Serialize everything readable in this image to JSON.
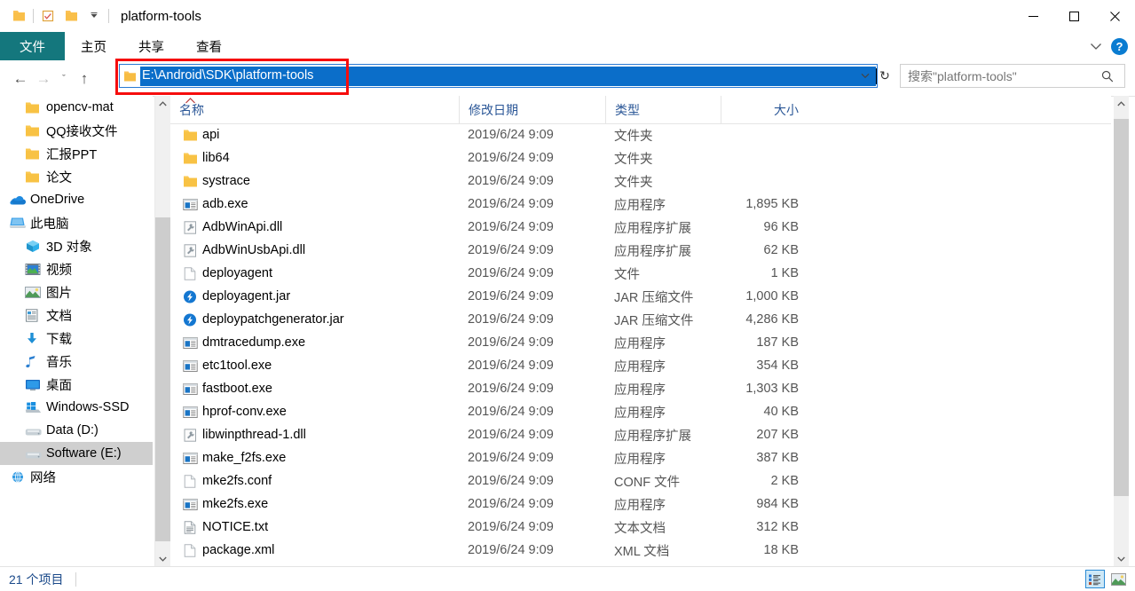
{
  "window": {
    "title": "platform-tools",
    "quick_access": [
      {
        "name": "folder-icon",
        "label": "folder"
      },
      {
        "name": "properties-icon",
        "label": "properties"
      },
      {
        "name": "new-folder-icon",
        "label": "new folder"
      },
      {
        "name": "chevron-down-icon",
        "label": "customize quick access toolbar"
      }
    ],
    "controls": {
      "minimize": "─",
      "maximize": "□",
      "close": "✕"
    }
  },
  "ribbon": {
    "tabs": [
      {
        "label": "文件",
        "active": true
      },
      {
        "label": "主页",
        "active": false
      },
      {
        "label": "共享",
        "active": false
      },
      {
        "label": "查看",
        "active": false
      }
    ],
    "collapse_icon": "chevron-down-icon",
    "help_label": "?",
    "accent_color": "#14777d"
  },
  "address": {
    "back_icon": "←",
    "forward_icon": "→",
    "recent_icon": "ˇ",
    "up_icon": "↑",
    "value": "E:\\Android\\SDK\\platform-tools",
    "dropdown_icon": "ˇ",
    "refresh_icon": "↻",
    "selected": true,
    "selection_color": "#0b6ec9"
  },
  "search": {
    "placeholder": "搜索\"platform-tools\"",
    "icon": "search-icon"
  },
  "annotation": {
    "color": "#f60d0d",
    "target": "address-bar"
  },
  "sidebar": {
    "items": [
      {
        "label": "opencv-mat",
        "icon": "folder-icon",
        "indent": 2,
        "selected": false
      },
      {
        "label": "QQ接收文件",
        "icon": "folder-icon",
        "indent": 2,
        "selected": false
      },
      {
        "label": "汇报PPT",
        "icon": "folder-icon",
        "indent": 2,
        "selected": false
      },
      {
        "label": "论文",
        "icon": "folder-icon",
        "indent": 2,
        "selected": false
      },
      {
        "label": "OneDrive",
        "icon": "onedrive-icon",
        "indent": 0,
        "selected": false
      },
      {
        "label": "此电脑",
        "icon": "this-pc-icon",
        "indent": 0,
        "selected": false
      },
      {
        "label": "3D 对象",
        "icon": "3d-objects-icon",
        "indent": 2,
        "selected": false
      },
      {
        "label": "视频",
        "icon": "videos-icon",
        "indent": 2,
        "selected": false
      },
      {
        "label": "图片",
        "icon": "pictures-icon",
        "indent": 2,
        "selected": false
      },
      {
        "label": "文档",
        "icon": "documents-icon",
        "indent": 2,
        "selected": false
      },
      {
        "label": "下载",
        "icon": "downloads-icon",
        "indent": 2,
        "selected": false
      },
      {
        "label": "音乐",
        "icon": "music-icon",
        "indent": 2,
        "selected": false
      },
      {
        "label": "桌面",
        "icon": "desktop-icon",
        "indent": 2,
        "selected": false
      },
      {
        "label": "Windows-SSD",
        "icon": "windows-drive-icon",
        "indent": 2,
        "selected": false
      },
      {
        "label": "Data (D:)",
        "icon": "drive-icon",
        "indent": 2,
        "selected": false
      },
      {
        "label": "Software (E:)",
        "icon": "drive-icon",
        "indent": 2,
        "selected": true
      },
      {
        "label": "网络",
        "icon": "network-icon",
        "indent": 0,
        "selected": false
      }
    ]
  },
  "filelist": {
    "columns": [
      {
        "label": "名称",
        "key": "name"
      },
      {
        "label": "修改日期",
        "key": "date"
      },
      {
        "label": "类型",
        "key": "type"
      },
      {
        "label": "大小",
        "key": "size"
      }
    ],
    "sort_column": "名称",
    "sort_direction": "asc",
    "rows": [
      {
        "name": "api",
        "date": "2019/6/24 9:09",
        "type": "文件夹",
        "size": "",
        "icon": "folder-icon"
      },
      {
        "name": "lib64",
        "date": "2019/6/24 9:09",
        "type": "文件夹",
        "size": "",
        "icon": "folder-icon"
      },
      {
        "name": "systrace",
        "date": "2019/6/24 9:09",
        "type": "文件夹",
        "size": "",
        "icon": "folder-icon"
      },
      {
        "name": "adb.exe",
        "date": "2019/6/24 9:09",
        "type": "应用程序",
        "size": "1,895 KB",
        "icon": "exe-icon"
      },
      {
        "name": "AdbWinApi.dll",
        "date": "2019/6/24 9:09",
        "type": "应用程序扩展",
        "size": "96 KB",
        "icon": "dll-icon"
      },
      {
        "name": "AdbWinUsbApi.dll",
        "date": "2019/6/24 9:09",
        "type": "应用程序扩展",
        "size": "62 KB",
        "icon": "dll-icon"
      },
      {
        "name": "deployagent",
        "date": "2019/6/24 9:09",
        "type": "文件",
        "size": "1 KB",
        "icon": "generic-file-icon"
      },
      {
        "name": "deployagent.jar",
        "date": "2019/6/24 9:09",
        "type": "JAR 压缩文件",
        "size": "1,000 KB",
        "icon": "jar-icon"
      },
      {
        "name": "deploypatchgenerator.jar",
        "date": "2019/6/24 9:09",
        "type": "JAR 压缩文件",
        "size": "4,286 KB",
        "icon": "jar-icon"
      },
      {
        "name": "dmtracedump.exe",
        "date": "2019/6/24 9:09",
        "type": "应用程序",
        "size": "187 KB",
        "icon": "exe-icon"
      },
      {
        "name": "etc1tool.exe",
        "date": "2019/6/24 9:09",
        "type": "应用程序",
        "size": "354 KB",
        "icon": "exe-icon"
      },
      {
        "name": "fastboot.exe",
        "date": "2019/6/24 9:09",
        "type": "应用程序",
        "size": "1,303 KB",
        "icon": "exe-icon"
      },
      {
        "name": "hprof-conv.exe",
        "date": "2019/6/24 9:09",
        "type": "应用程序",
        "size": "40 KB",
        "icon": "exe-icon"
      },
      {
        "name": "libwinpthread-1.dll",
        "date": "2019/6/24 9:09",
        "type": "应用程序扩展",
        "size": "207 KB",
        "icon": "dll-icon"
      },
      {
        "name": "make_f2fs.exe",
        "date": "2019/6/24 9:09",
        "type": "应用程序",
        "size": "387 KB",
        "icon": "exe-icon"
      },
      {
        "name": "mke2fs.conf",
        "date": "2019/6/24 9:09",
        "type": "CONF 文件",
        "size": "2 KB",
        "icon": "generic-file-icon"
      },
      {
        "name": "mke2fs.exe",
        "date": "2019/6/24 9:09",
        "type": "应用程序",
        "size": "984 KB",
        "icon": "exe-icon"
      },
      {
        "name": "NOTICE.txt",
        "date": "2019/6/24 9:09",
        "type": "文本文档",
        "size": "312 KB",
        "icon": "txt-icon"
      },
      {
        "name": "package.xml",
        "date": "2019/6/24 9:09",
        "type": "XML 文档",
        "size": "18 KB",
        "icon": "generic-file-icon"
      }
    ]
  },
  "status": {
    "item_count": "21 个项目",
    "views": [
      {
        "name": "details-view",
        "active": true
      },
      {
        "name": "large-icons-view",
        "active": false
      }
    ]
  }
}
